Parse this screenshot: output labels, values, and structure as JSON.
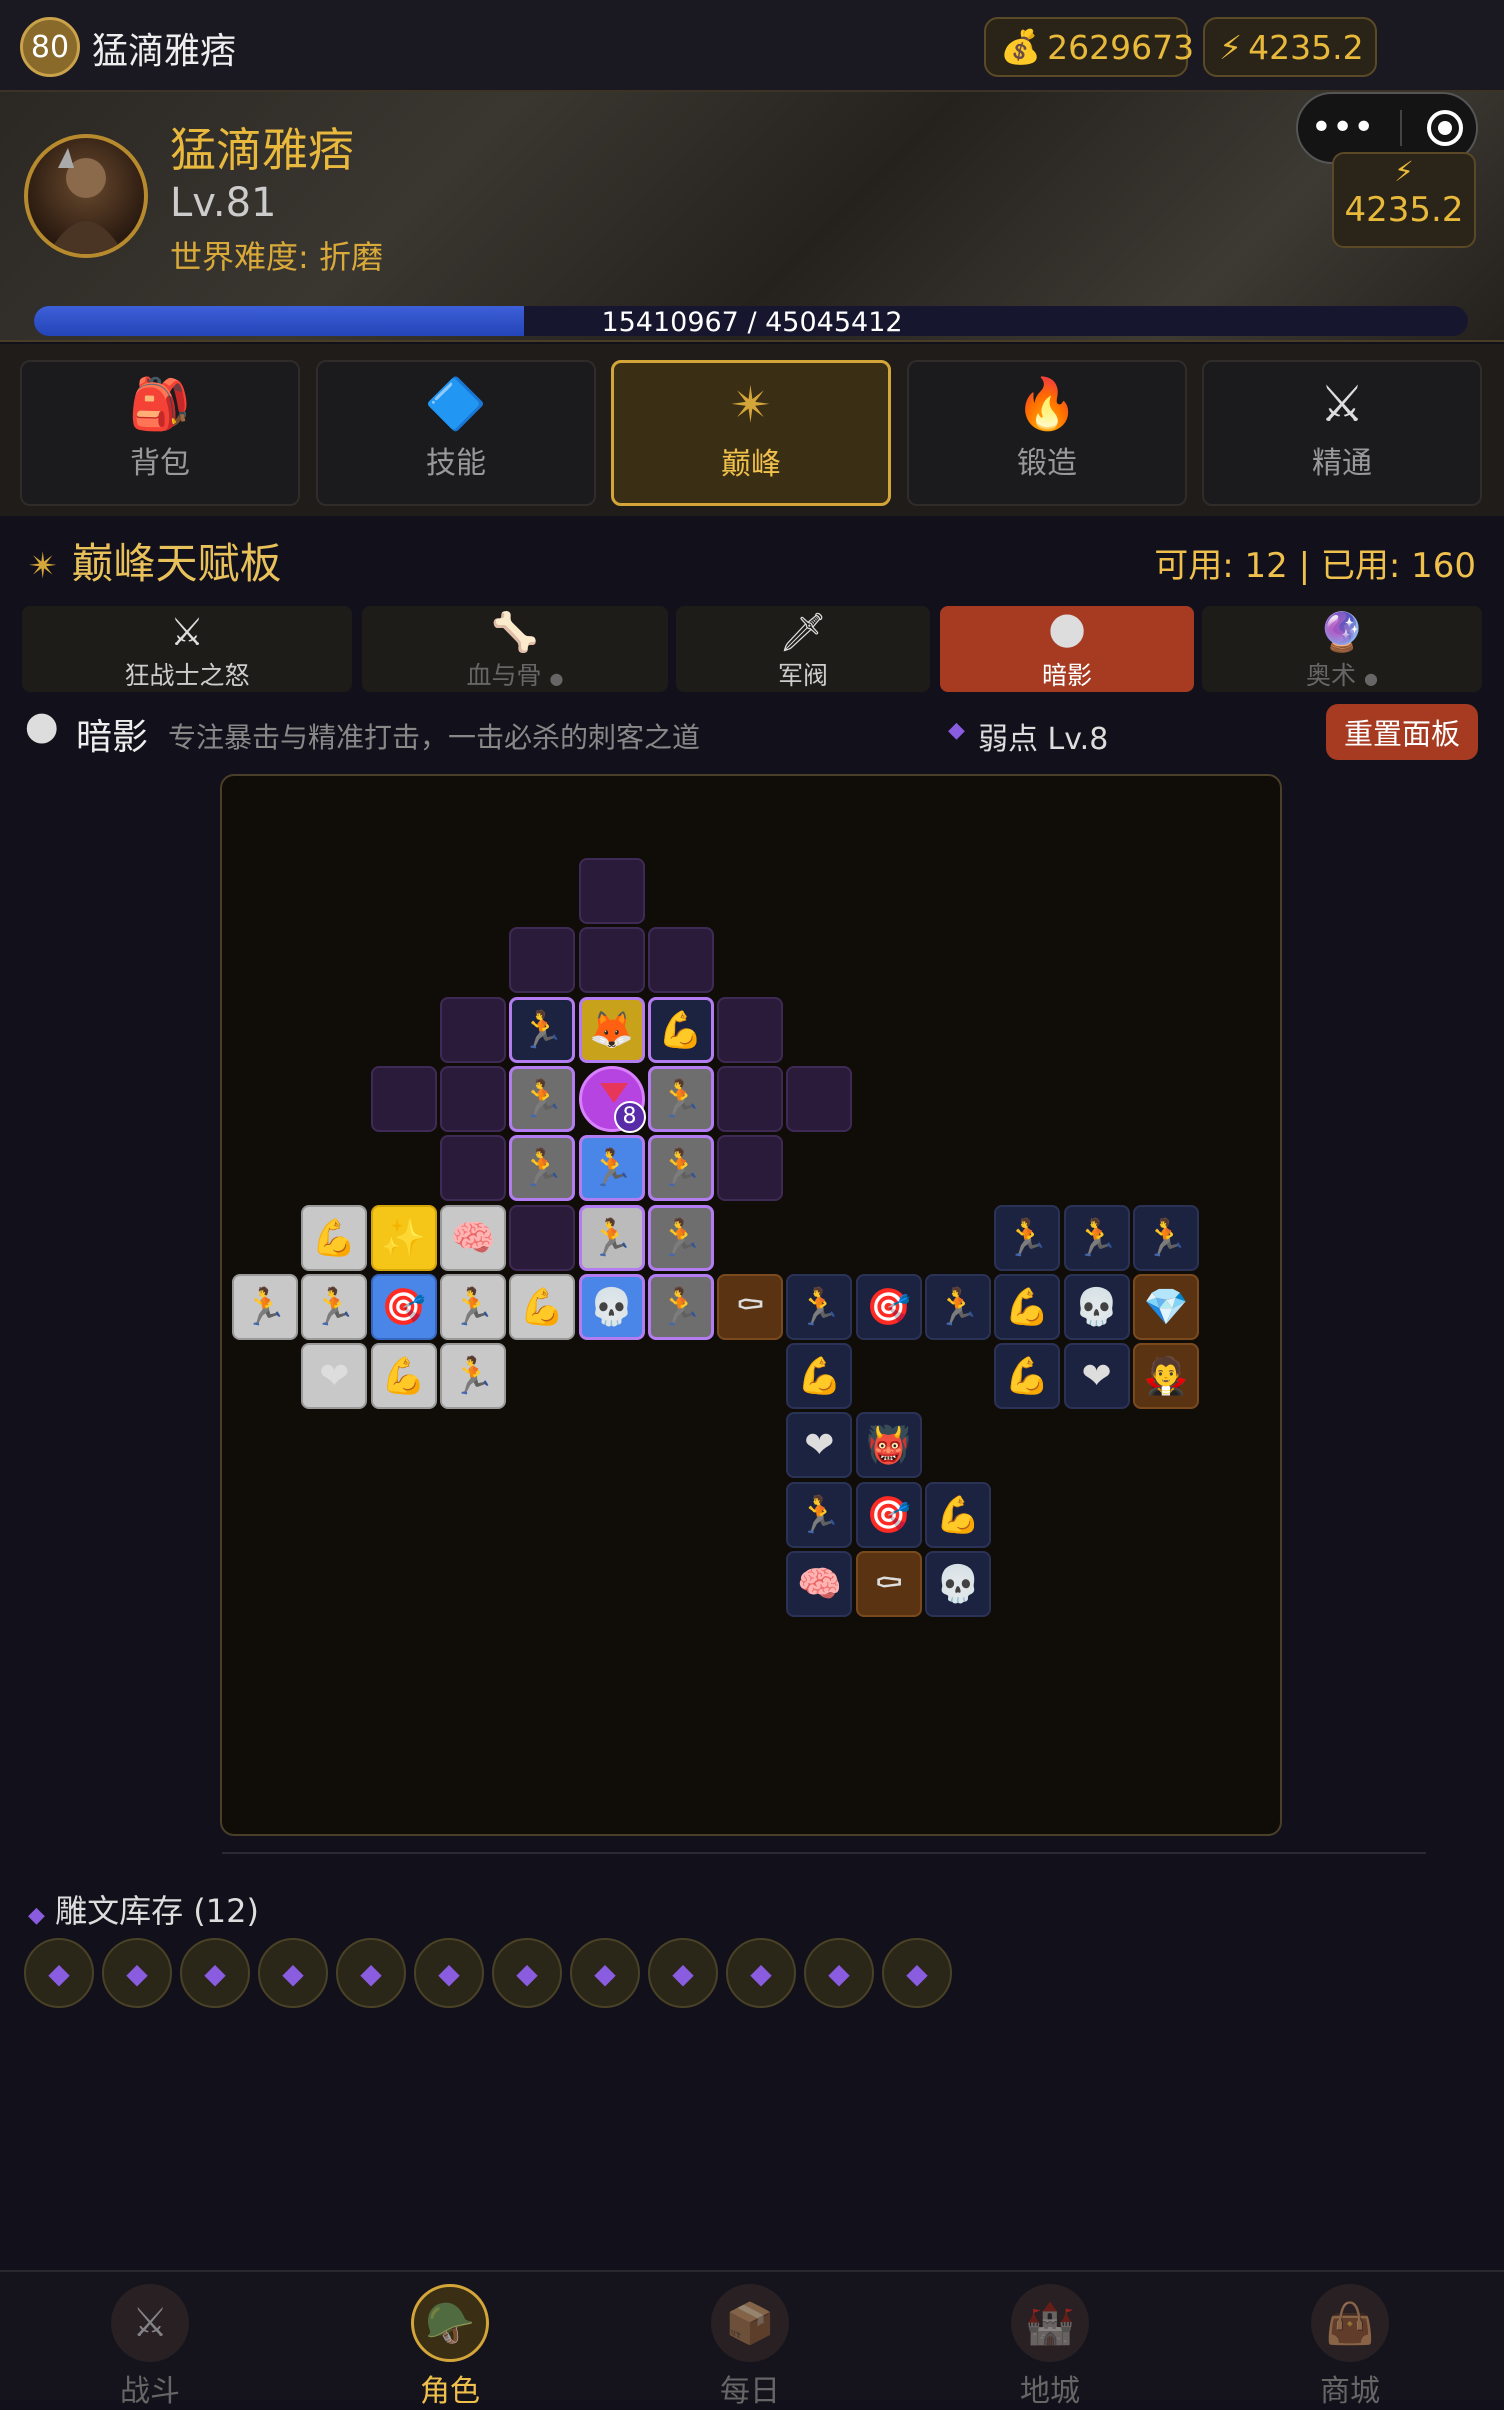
{
  "top": {
    "level_badge": "80",
    "name": "猛滴雅痞",
    "gold": "2629673",
    "energy": "4235.2",
    "gold_icon": "money-bag-icon",
    "energy_icon": "lightning-icon"
  },
  "hero": {
    "name": "猛滴雅痞",
    "level": "Lv.81",
    "difficulty": "世界难度: 折磨",
    "energy": "4235.2",
    "xp_text": "15410967 / 45045412",
    "xp_progress": 0.342
  },
  "tabs": [
    {
      "label": "背包",
      "icon": "backpack-icon",
      "glyph": "🎒"
    },
    {
      "label": "技能",
      "icon": "rune-stone-icon",
      "glyph": "🔷"
    },
    {
      "label": "巅峰",
      "icon": "compass-star-icon",
      "glyph": "✴"
    },
    {
      "label": "锻造",
      "icon": "forge-icon",
      "glyph": "🔥"
    },
    {
      "label": "精通",
      "icon": "crossed-swords-icon",
      "glyph": "⚔"
    }
  ],
  "paragon": {
    "title": "巅峰天赋板",
    "counts": "可用: 12 | 已用: 160"
  },
  "boards": [
    {
      "label": "狂战士之怒",
      "glyph": "⚔"
    },
    {
      "label": "血与骨",
      "glyph": "🦴"
    },
    {
      "label": "军阀",
      "glyph": "🗡"
    },
    {
      "label": "暗影",
      "glyph": "🌑"
    },
    {
      "label": "奥术",
      "glyph": "🔮"
    }
  ],
  "current_board": {
    "name": "暗影",
    "desc": "专注暴击与精准打击，一击必杀的刺客之道",
    "glyph_name": "弱点 Lv.8",
    "reset_label": "重置面板"
  },
  "center_node": {
    "level": "8"
  },
  "stock": {
    "title": "雕文库存 (12)",
    "count": 12
  },
  "nav": [
    {
      "label": "战斗"
    },
    {
      "label": "角色"
    },
    {
      "label": "每日"
    },
    {
      "label": "地城"
    },
    {
      "label": "商城"
    }
  ],
  "colors": {
    "accent": "#f0c04c",
    "reset": "#a63b22",
    "allocated_border": "#b37cf0",
    "xp": "#3d5fd8"
  }
}
